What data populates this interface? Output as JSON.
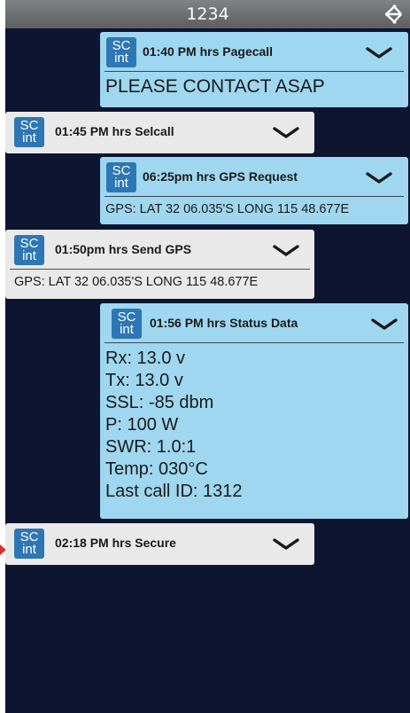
{
  "header": {
    "title": "1234"
  },
  "badge": {
    "line1": "SC",
    "line2": "int"
  },
  "messages": [
    {
      "title": "01:40 PM hrs  Pagecall",
      "body": "PLEASE CONTACT ASAP"
    },
    {
      "title": "01:45 PM hrs  Selcall"
    },
    {
      "title": "06:25pm hrs GPS Request",
      "body": "GPS: LAT 32 06.035'S LONG 115 48.677E"
    },
    {
      "title": "01:50pm hrs Send GPS",
      "body": "GPS: LAT 32 06.035'S LONG 115 48.677E"
    },
    {
      "title": "01:56 PM hrs Status Data",
      "lines": [
        "Rx: 13.0 v",
        "Tx: 13.0 v",
        "SSL: -85 dbm",
        "P: 100 W",
        "SWR: 1.0:1",
        "Temp: 030°C",
        "Last call ID: 1312"
      ]
    },
    {
      "title": "02:18 PM hrs  Secure"
    }
  ],
  "colors": {
    "background": "#0d1530",
    "incoming": "#9ed7ef",
    "outgoing": "#e9e9e9",
    "badge": "#2d77b4"
  }
}
